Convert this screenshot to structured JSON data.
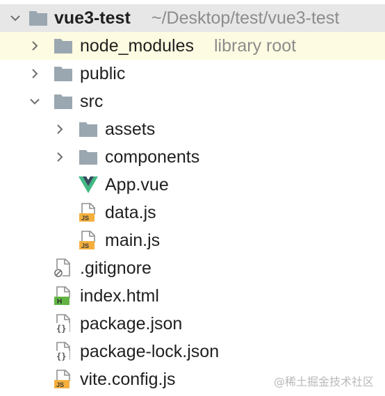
{
  "project": {
    "name": "vue3-test",
    "path": "~/Desktop/test/vue3-test"
  },
  "items": [
    {
      "label": "node_modules",
      "hint": "library root",
      "type": "folder",
      "expanded": false
    },
    {
      "label": "public",
      "type": "folder",
      "expanded": false
    },
    {
      "label": "src",
      "type": "folder",
      "expanded": true
    },
    {
      "label": "assets",
      "type": "folder",
      "expanded": false
    },
    {
      "label": "components",
      "type": "folder",
      "expanded": false
    },
    {
      "label": "App.vue",
      "type": "vue-file"
    },
    {
      "label": "data.js",
      "type": "js-file"
    },
    {
      "label": "main.js",
      "type": "js-file"
    },
    {
      "label": ".gitignore",
      "type": "ignore-file"
    },
    {
      "label": "index.html",
      "type": "html-file"
    },
    {
      "label": "package.json",
      "type": "json-file"
    },
    {
      "label": "package-lock.json",
      "type": "json-file"
    },
    {
      "label": "vite.config.js",
      "type": "js-file"
    }
  ],
  "watermark": "@稀土掘金技术社区",
  "colors": {
    "folder": "#9aa7b0",
    "root_bg": "#e7e7e7",
    "highlight_bg": "#fdfbe1",
    "js_badge": "#f4af3d",
    "html_badge": "#62b543",
    "vue_green": "#41b883",
    "vue_dark": "#35495e"
  }
}
